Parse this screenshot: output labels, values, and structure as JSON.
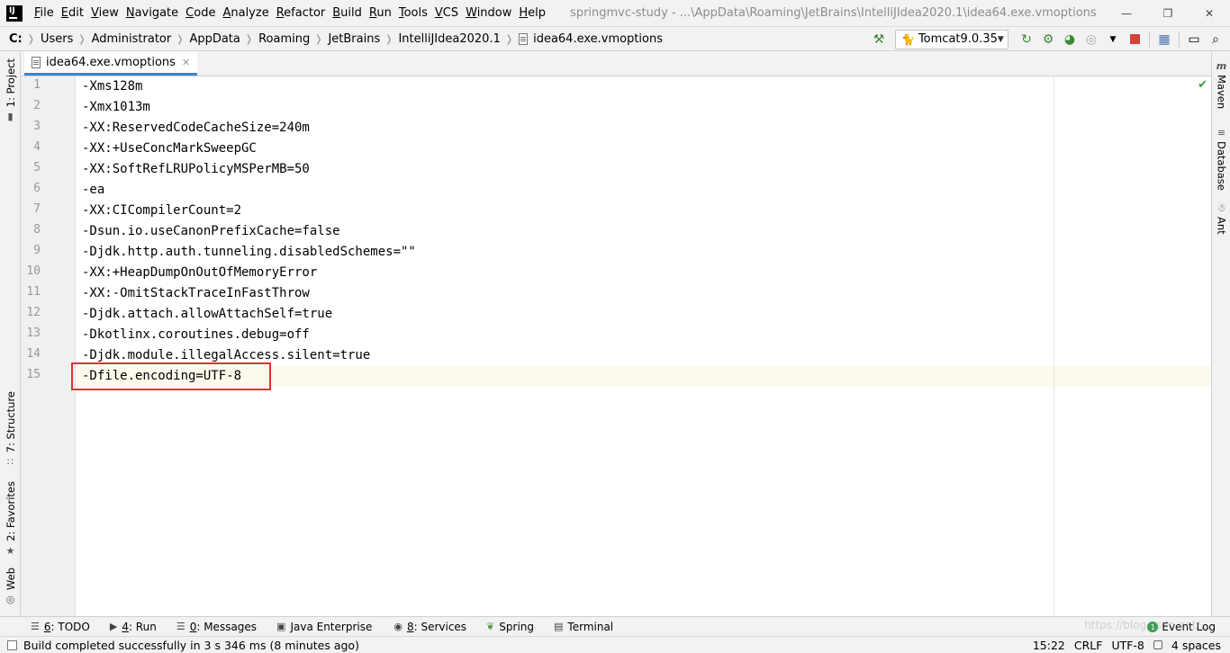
{
  "menubar": {
    "items": [
      "File",
      "Edit",
      "View",
      "Navigate",
      "Code",
      "Analyze",
      "Refactor",
      "Build",
      "Run",
      "Tools",
      "VCS",
      "Window",
      "Help"
    ],
    "window_title": "springmvc-study - ...\\AppData\\Roaming\\JetBrains\\IntelliJIdea2020.1\\idea64.exe.vmoptions"
  },
  "navbar": {
    "crumbs": [
      "C:",
      "Users",
      "Administrator",
      "AppData",
      "Roaming",
      "JetBrains",
      "IntelliJIdea2020.1",
      "idea64.exe.vmoptions"
    ],
    "run_config": "Tomcat9.0.35"
  },
  "left_strip": {
    "project": "1: Project",
    "structure": "7: Structure",
    "favorites": "2: Favorites",
    "web": "Web"
  },
  "right_strip": {
    "maven": "Maven",
    "database": "Database",
    "ant": "Ant"
  },
  "editor": {
    "tab_label": "idea64.exe.vmoptions",
    "lines": [
      {
        "num": "1",
        "text": "-Xms128m"
      },
      {
        "num": "2",
        "text": "-Xmx1013m"
      },
      {
        "num": "3",
        "text": "-XX:ReservedCodeCacheSize=240m"
      },
      {
        "num": "4",
        "text": "-XX:+UseConcMarkSweepGC"
      },
      {
        "num": "5",
        "text": "-XX:SoftRefLRUPolicyMSPerMB=50"
      },
      {
        "num": "6",
        "text": "-ea"
      },
      {
        "num": "7",
        "text": "-XX:CICompilerCount=2"
      },
      {
        "num": "8",
        "text": "-Dsun.io.useCanonPrefixCache=false"
      },
      {
        "num": "9",
        "text": "-Djdk.http.auth.tunneling.disabledSchemes=\"\""
      },
      {
        "num": "10",
        "text": "-XX:+HeapDumpOnOutOfMemoryError"
      },
      {
        "num": "11",
        "text": "-XX:-OmitStackTraceInFastThrow"
      },
      {
        "num": "12",
        "text": "-Djdk.attach.allowAttachSelf=true"
      },
      {
        "num": "13",
        "text": "-Dkotlinx.coroutines.debug=off"
      },
      {
        "num": "14",
        "text": "-Djdk.module.illegalAccess.silent=true"
      },
      {
        "num": "15",
        "text": "-Dfile.encoding=UTF-8"
      }
    ]
  },
  "tool_windows": {
    "todo": {
      "num": "6",
      "label": ": TODO"
    },
    "run": {
      "num": "4",
      "label": ": Run"
    },
    "messages": {
      "num": "0",
      "label": ": Messages"
    },
    "java_enterprise": "Java Enterprise",
    "services": {
      "num": "8",
      "label": ": Services"
    },
    "spring": "Spring",
    "terminal": "Terminal",
    "event_log": "Event Log"
  },
  "statusbar": {
    "message": "Build completed successfully in 3 s 346 ms (8 minutes ago)",
    "position": "15:22",
    "line_sep": "CRLF",
    "encoding": "UTF-8",
    "indent": "4 spaces"
  },
  "watermark": "https://blog.csdn.net/..."
}
